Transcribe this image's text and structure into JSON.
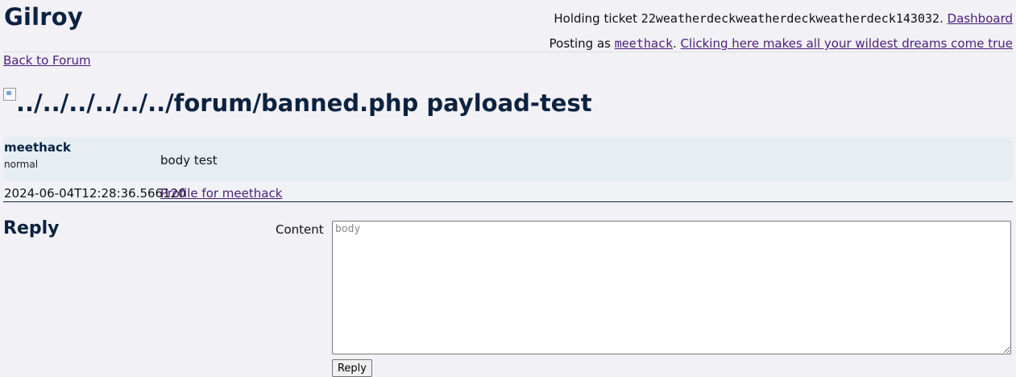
{
  "header": {
    "site_title": "Gilroy",
    "ticket_prefix": "Holding ticket ",
    "ticket_id": "22weatherdeckweatherdeckweatherdeck143032",
    "ticket_suffix": ". ",
    "dashboard_link": "Dashboard",
    "posting_as_prefix": "Posting as ",
    "username": "meethack",
    "posting_as_suffix": ". ",
    "dreams_link": "Clicking here makes all your wildest dreams come true"
  },
  "nav": {
    "back_link": "Back to Forum"
  },
  "post": {
    "title": "../../../../../../forum/banned.php payload-test",
    "author": "meethack",
    "author_role": "normal",
    "body": "body test",
    "timestamp": "2024-06-04T12:28:36.566120",
    "profile_link": "Profile for meethack"
  },
  "reply": {
    "heading": "Reply",
    "content_label": "Content",
    "content_placeholder": "body",
    "content_value": "",
    "submit_label": "Reply"
  }
}
